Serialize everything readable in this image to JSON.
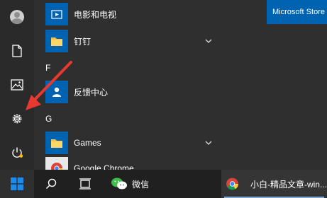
{
  "start_menu": {
    "apps": [
      {
        "name": "电影和电视",
        "has_chevron": false
      },
      {
        "name": "钉钉",
        "has_chevron": true
      },
      {
        "name": "反馈中心",
        "has_chevron": false
      },
      {
        "name": "Games",
        "has_chevron": true
      },
      {
        "name": "Google Chrome",
        "has_chevron": false
      }
    ],
    "section_letters": [
      "F",
      "G"
    ],
    "pinned_tile": "Microsoft Store"
  },
  "taskbar": {
    "wechat_label": "微信",
    "chrome_window_label": "小白-精品文章-win..."
  },
  "colors": {
    "accent": "#0063b1",
    "folder": "#f4c24d",
    "annotation": "#e8382f"
  }
}
